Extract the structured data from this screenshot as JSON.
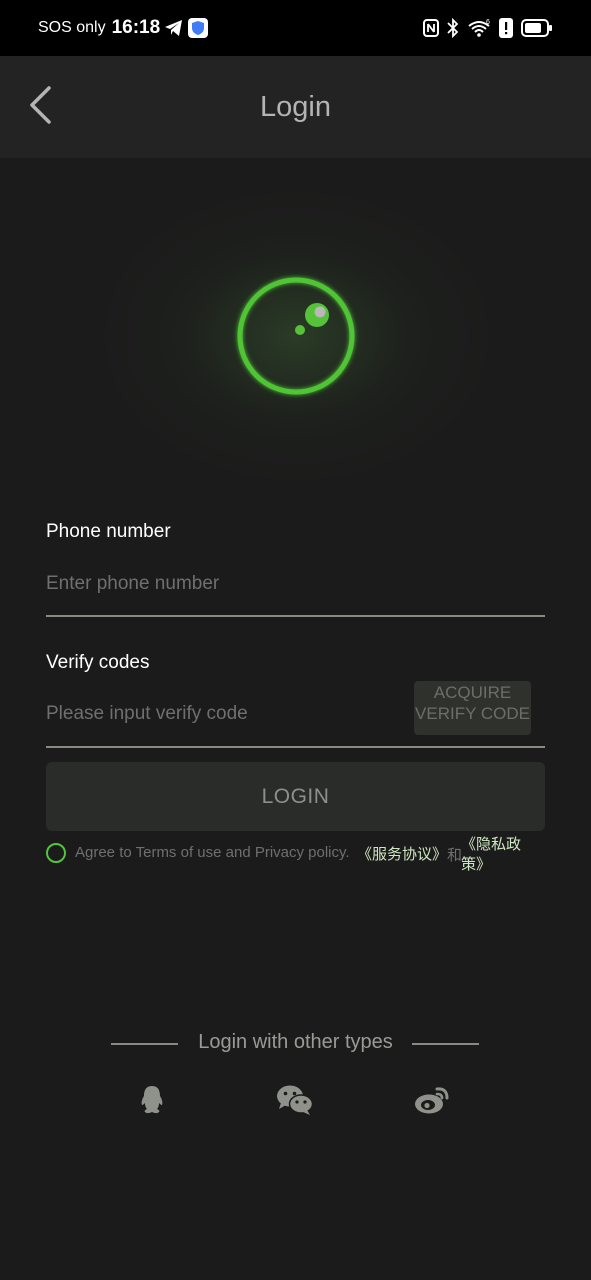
{
  "status_bar": {
    "carrier": "SOS only",
    "time": "16:18",
    "icons": [
      "telegram-icon",
      "shield-app-icon",
      "nfc-icon",
      "bluetooth-icon",
      "wifi-icon",
      "alert-icon",
      "battery-icon"
    ],
    "wifi_badge": "6"
  },
  "header": {
    "title": "Login",
    "back_icon": "chevron-left-icon"
  },
  "form": {
    "phone": {
      "label": "Phone number",
      "placeholder": "Enter phone number",
      "value": ""
    },
    "verify": {
      "label": "Verify codes",
      "placeholder": "Please input verify code",
      "value": "",
      "acquire_label": "ACQUIRE VERIFY CODE"
    },
    "login_label": "LOGIN"
  },
  "agreement": {
    "text": "Agree to Terms of use and Privacy policy.",
    "service_link": "《服务协议》",
    "and_text": "和",
    "privacy_link": "《隐私政策》",
    "checked": false
  },
  "other_login": {
    "label": "Login with other types",
    "providers": [
      "qq-icon",
      "wechat-icon",
      "weibo-icon"
    ]
  },
  "colors": {
    "background": "#1b1b1b",
    "header": "#232323",
    "accent_green": "#52c63a",
    "link": "#cfe7c0"
  }
}
